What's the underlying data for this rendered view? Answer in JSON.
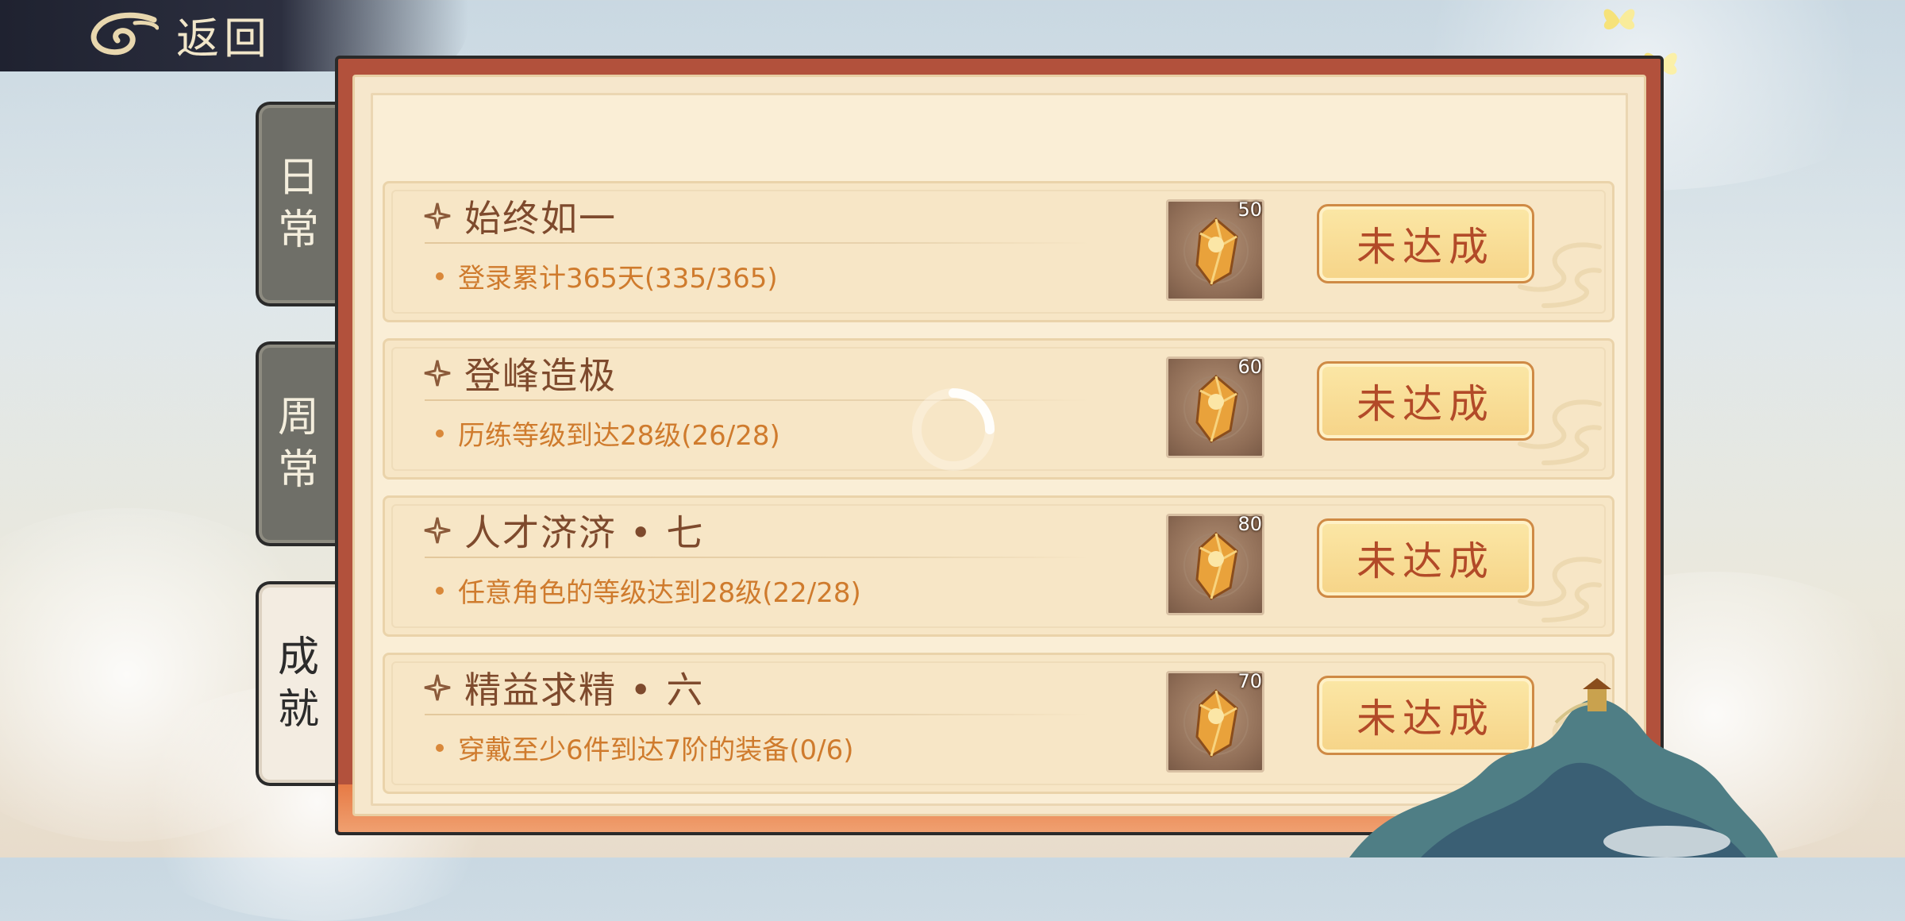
{
  "header": {
    "back_label": "返回"
  },
  "tabs": [
    {
      "chars": [
        "日",
        "常"
      ],
      "active": false
    },
    {
      "chars": [
        "周",
        "常"
      ],
      "active": false
    },
    {
      "chars": [
        "成",
        "就"
      ],
      "active": true
    }
  ],
  "achievements": [
    {
      "title": "始终如一",
      "desc": "登录累计365天(335/365)",
      "reward_count": "50",
      "status": "未达成"
    },
    {
      "title": "登峰造极",
      "desc": "历练等级到达28级(26/28)",
      "reward_count": "60",
      "status": "未达成"
    },
    {
      "title": "人才济济 • 七",
      "desc": "任意角色的等级达到28级(22/28)",
      "reward_count": "80",
      "status": "未达成"
    },
    {
      "title": "精益求精 • 六",
      "desc": "穿戴至少6件到达7阶的装备(0/6)",
      "reward_count": "70",
      "status": "未达成"
    }
  ],
  "icons": {
    "back": "swirl-cloud-icon",
    "title_marker": "four-point-star-icon",
    "reward": "gold-crystal-icon",
    "loading": "loading-spinner-icon"
  },
  "colors": {
    "panel_frame": "#b2513c",
    "panel_bg": "#f6e7cc",
    "title_text": "#7e4a2d",
    "desc_text": "#cf7b2d",
    "status_text": "#b24a28",
    "status_bg": "#f6d488"
  }
}
